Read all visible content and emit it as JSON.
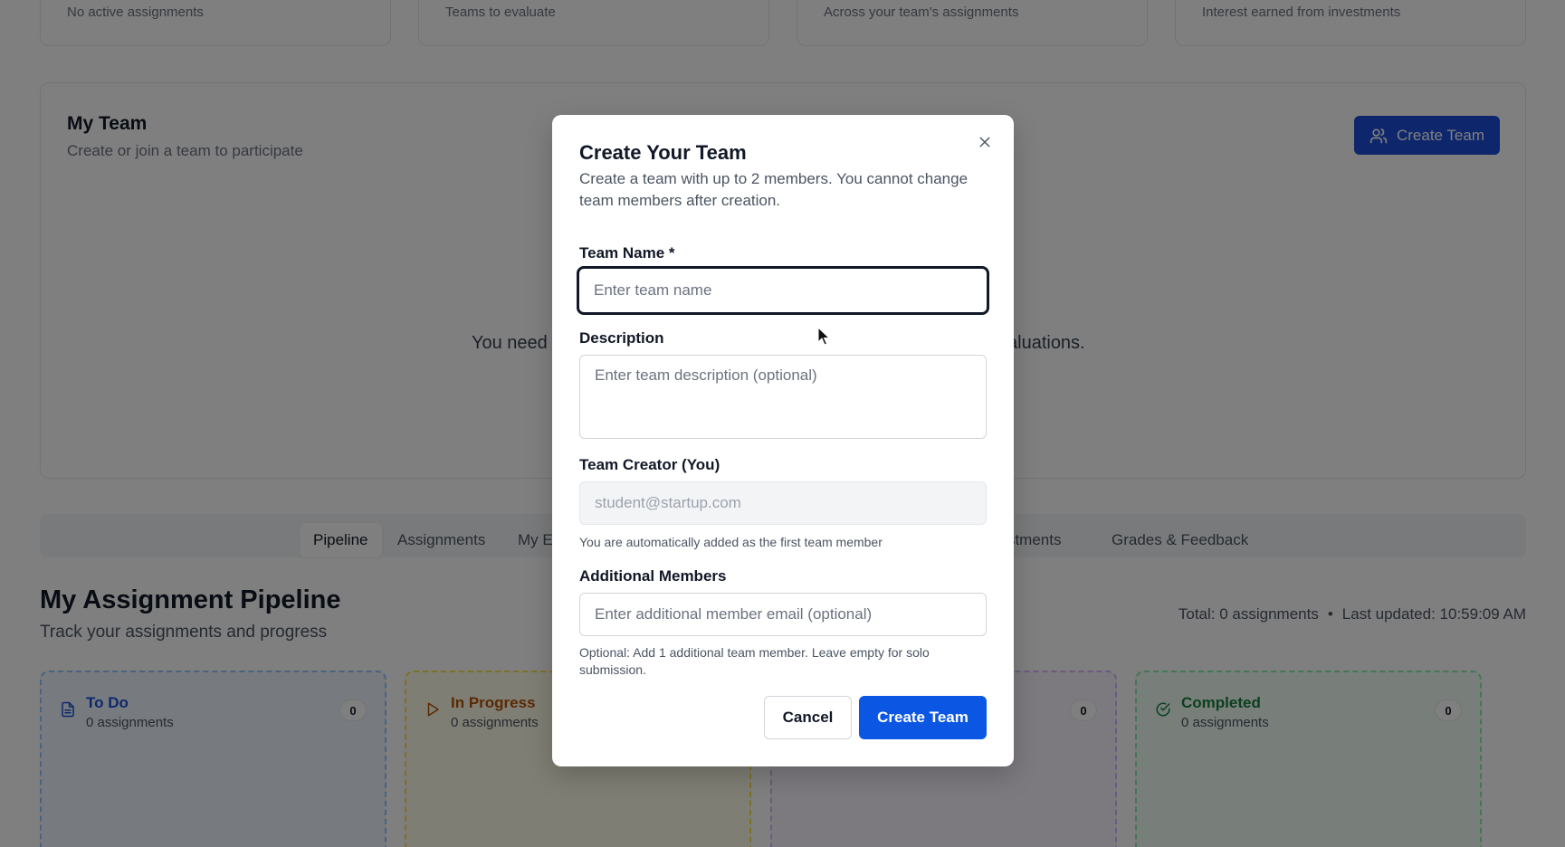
{
  "stats": [
    {
      "sub": "No active assignments"
    },
    {
      "sub": "Teams to evaluate"
    },
    {
      "sub": "Across your team's assignments"
    },
    {
      "sub": "Interest earned from investments"
    }
  ],
  "team": {
    "title": "My Team",
    "subtitle": "Create or join a team to participate",
    "create_button": "Create Team",
    "empty_message_left": "You need",
    "empty_message_right": "aluations."
  },
  "tabs": [
    {
      "label": "Pipeline"
    },
    {
      "label": "Assignments"
    },
    {
      "label": "My E"
    },
    {
      "label": "vestments"
    },
    {
      "label": "Grades & Feedback"
    }
  ],
  "pipeline": {
    "title": "My Assignment Pipeline",
    "subtitle": "Track your assignments and progress",
    "total": "Total: 0 assignments",
    "separator": "•",
    "updated": "Last updated: 10:59:09 AM",
    "columns": [
      {
        "name": "To Do",
        "count_text": "0 assignments",
        "badge": "0"
      },
      {
        "name": "In Progress",
        "count_text": "0 assignments",
        "badge": ""
      },
      {
        "name": "",
        "count_text": "",
        "badge": "0"
      },
      {
        "name": "Completed",
        "count_text": "0 assignments",
        "badge": "0"
      }
    ]
  },
  "modal": {
    "title": "Create Your Team",
    "description": "Create a team with up to 2 members. You cannot change team members after creation.",
    "team_name_label": "Team Name *",
    "team_name_placeholder": "Enter team name",
    "description_label": "Description",
    "description_placeholder": "Enter team description (optional)",
    "creator_label": "Team Creator (You)",
    "creator_value": "student@startup.com",
    "creator_help": "You are automatically added as the first team member",
    "members_label": "Additional Members",
    "members_placeholder": "Enter additional member email (optional)",
    "members_help": "Optional: Add 1 additional team member. Leave empty for solo submission.",
    "cancel_label": "Cancel",
    "create_label": "Create Team"
  },
  "colors": {
    "primary": "#0b57e3",
    "overlay": "rgba(0,0,0,0.5)"
  }
}
